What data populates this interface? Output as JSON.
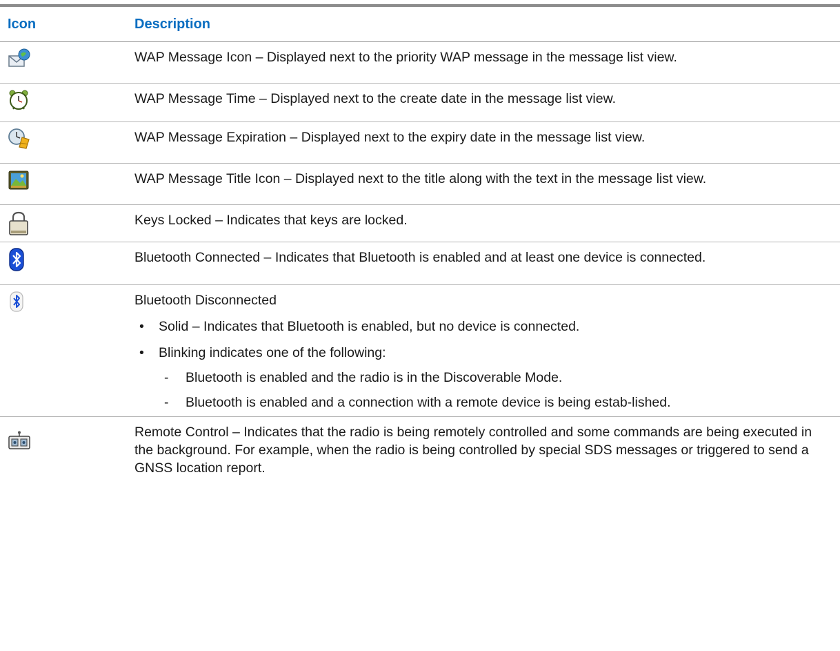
{
  "header": {
    "col_icon": "Icon",
    "col_desc": "Description"
  },
  "rows": [
    {
      "icon": "wap-message-icon",
      "text": "WAP Message Icon – Displayed next to the priority WAP message in the message list view."
    },
    {
      "icon": "alarm-clock-icon",
      "text": "WAP Message Time – Displayed next to the create date in the message list view."
    },
    {
      "icon": "expiration-clock-icon",
      "text": "WAP Message Expiration – Displayed next to the expiry date in the message list view."
    },
    {
      "icon": "title-image-icon",
      "text": "WAP Message Title Icon – Displayed next to the title along with the text in the message list view."
    },
    {
      "icon": "lock-icon",
      "text": "Keys Locked – Indicates that keys are locked."
    },
    {
      "icon": "bluetooth-connected-icon",
      "text": "Bluetooth Connected – Indicates that Bluetooth is enabled and at least one device is connected."
    },
    {
      "icon": "bluetooth-disconnected-icon",
      "text": "Bluetooth Disconnected",
      "bullets": [
        {
          "mark": "•",
          "text": "Solid – Indicates that Bluetooth is enabled, but no device is connected."
        },
        {
          "mark": "•",
          "text": "Blinking indicates one of the following:"
        }
      ],
      "sub_bullets": [
        {
          "mark": "-",
          "text": "Bluetooth is enabled and the radio is in the Discoverable Mode."
        },
        {
          "mark": "-",
          "text": "Bluetooth is enabled and a connection with a remote device is being estab-lished."
        }
      ]
    },
    {
      "icon": "remote-control-icon",
      "text": "Remote Control – Indicates that the radio is being remotely controlled and some commands are being executed in the background. For example, when the radio is being controlled by special SDS messages or triggered to send a GNSS location report."
    }
  ],
  "colors": {
    "header_text": "#0a6ec1",
    "rule": "#8c8c8c"
  }
}
